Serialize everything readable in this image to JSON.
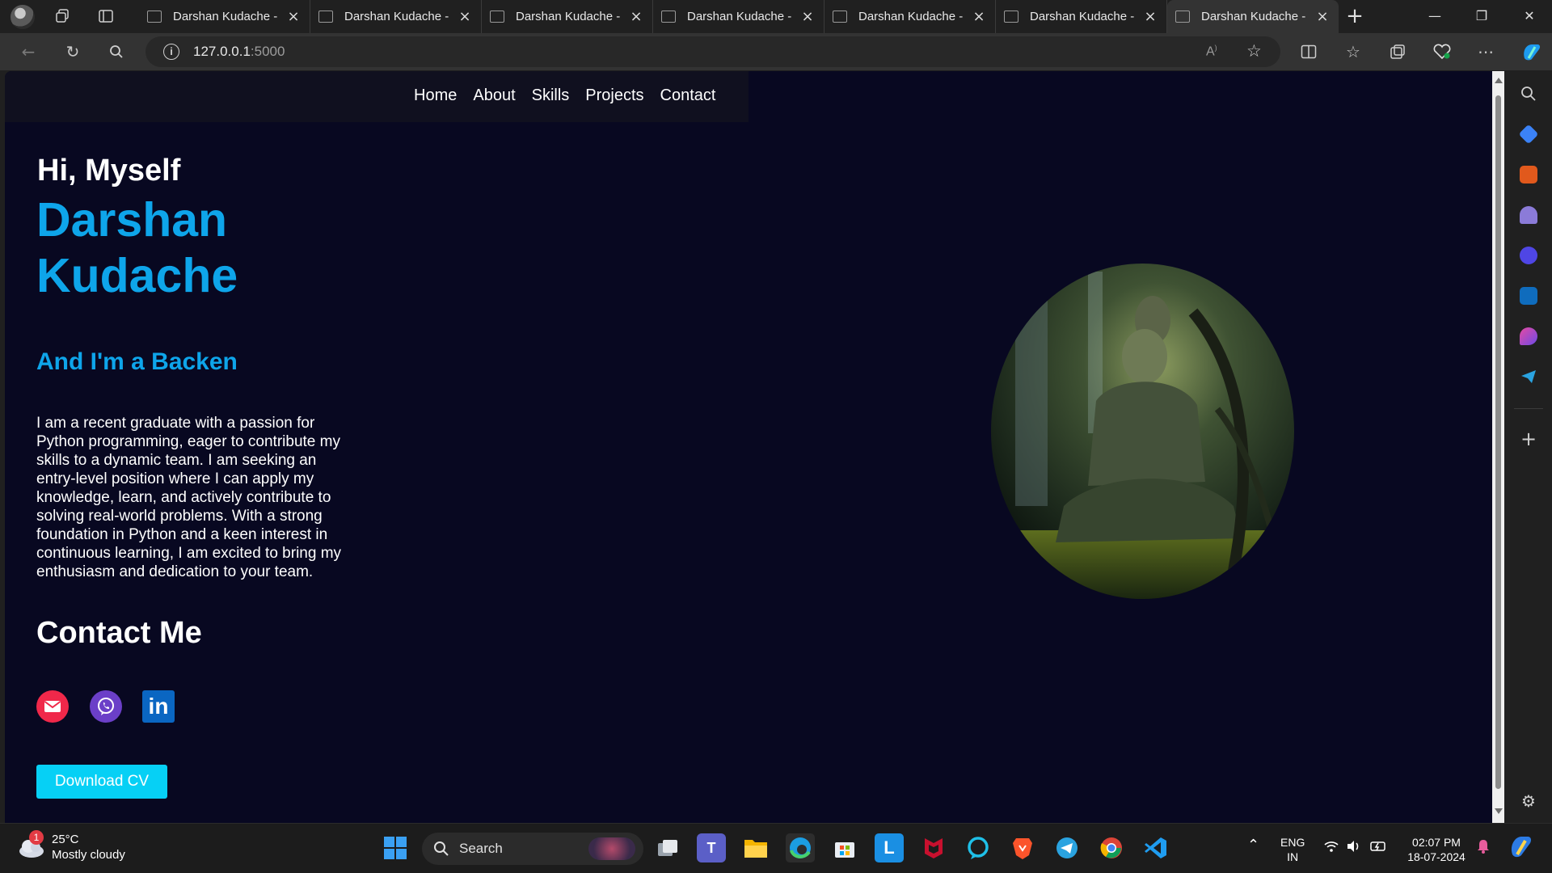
{
  "browser": {
    "tabs": [
      {
        "title": "Darshan Kudache -"
      },
      {
        "title": "Darshan Kudache -"
      },
      {
        "title": "Darshan Kudache -"
      },
      {
        "title": "Darshan Kudache -"
      },
      {
        "title": "Darshan Kudache -"
      },
      {
        "title": "Darshan Kudache -"
      },
      {
        "title": "Darshan Kudache -"
      }
    ],
    "active_tab": 6,
    "url_host": "127.0.0.1",
    "url_port": ":5000"
  },
  "page": {
    "nav": [
      "Home",
      "About",
      "Skills",
      "Projects",
      "Contact"
    ],
    "greeting": "Hi, Myself",
    "name": "Darshan Kudache",
    "role": "And I'm a Backen",
    "bio": "I am a recent graduate with a passion for Python programming, eager to contribute my skills to a dynamic team. I am seeking an entry-level position where I can apply my knowledge, learn, and actively contribute to solving real-world problems. With a strong foundation in Python and a keen interest in continuous learning, I am excited to bring my enthusiasm and dedication to your team.",
    "contact_title": "Contact Me",
    "social_icons": [
      "mail-icon",
      "viber-icon",
      "linkedin-icon"
    ],
    "linkedin_glyph": "in",
    "cv_button": "Download CV",
    "accent_color": "#0ea5ea",
    "background_color": "#080821"
  },
  "taskbar": {
    "weather_temp": "25°C",
    "weather_desc": "Mostly cloudy",
    "weather_badge": "1",
    "search_label": "Search",
    "lang_top": "ENG",
    "lang_bottom": "IN",
    "time": "02:07 PM",
    "date": "18-07-2024"
  }
}
